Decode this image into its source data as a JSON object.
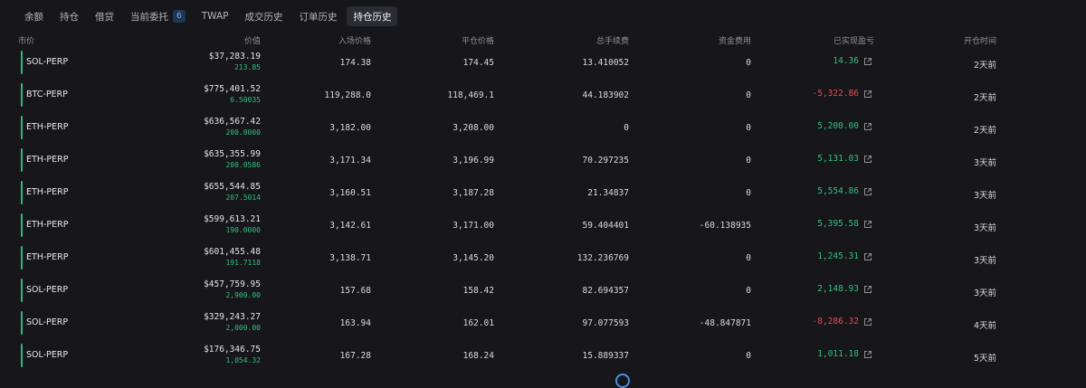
{
  "tabs": [
    {
      "label": "余额",
      "active": false
    },
    {
      "label": "持仓",
      "active": false
    },
    {
      "label": "借贷",
      "active": false
    },
    {
      "label": "当前委托",
      "badge": "6",
      "active": false
    },
    {
      "label": "TWAP",
      "active": false
    },
    {
      "label": "成交历史",
      "active": false
    },
    {
      "label": "订单历史",
      "active": false
    },
    {
      "label": "持仓历史",
      "active": true
    }
  ],
  "columns": {
    "market": "市价",
    "value": "价值",
    "entry_price": "入场价格",
    "close_price": "平仓价格",
    "total_fee": "总手续费",
    "funding": "资金费用",
    "realized_pnl": "已实现盈亏",
    "open_time": "开仓时间"
  },
  "colors": {
    "positive": "#33c07b",
    "negative": "#ea4a4f",
    "accent": "#74adf2"
  },
  "rows": [
    {
      "market": "SOL-PERP",
      "value": "$37,283.19",
      "size": "213.85",
      "entry": "174.38",
      "close": "174.45",
      "fee": "13.410052",
      "funding": "0",
      "pnl": "14.36",
      "pnl_sign": "pos",
      "time": "2天前"
    },
    {
      "market": "BTC-PERP",
      "value": "$775,401.52",
      "size": "6.50035",
      "entry": "119,288.0",
      "close": "118,469.1",
      "fee": "44.183902",
      "funding": "0",
      "pnl": "-5,322.86",
      "pnl_sign": "neg",
      "time": "2天前"
    },
    {
      "market": "ETH-PERP",
      "value": "$636,567.42",
      "size": "200.0000",
      "entry": "3,182.00",
      "close": "3,208.00",
      "fee": "0",
      "funding": "0",
      "pnl": "5,200.00",
      "pnl_sign": "pos",
      "time": "2天前"
    },
    {
      "market": "ETH-PERP",
      "value": "$635,355.99",
      "size": "200.0586",
      "entry": "3,171.34",
      "close": "3,196.99",
      "fee": "70.297235",
      "funding": "0",
      "pnl": "5,131.03",
      "pnl_sign": "pos",
      "time": "3天前"
    },
    {
      "market": "ETH-PERP",
      "value": "$655,544.85",
      "size": "207.5014",
      "entry": "3,160.51",
      "close": "3,187.28",
      "fee": "21.34837",
      "funding": "0",
      "pnl": "5,554.86",
      "pnl_sign": "pos",
      "time": "3天前"
    },
    {
      "market": "ETH-PERP",
      "value": "$599,613.21",
      "size": "190.0000",
      "entry": "3,142.61",
      "close": "3,171.00",
      "fee": "59.404401",
      "funding": "-60.138935",
      "pnl": "5,395.58",
      "pnl_sign": "pos",
      "time": "3天前"
    },
    {
      "market": "ETH-PERP",
      "value": "$601,455.48",
      "size": "191.7118",
      "entry": "3,138.71",
      "close": "3,145.20",
      "fee": "132.236769",
      "funding": "0",
      "pnl": "1,245.31",
      "pnl_sign": "pos",
      "time": "3天前"
    },
    {
      "market": "SOL-PERP",
      "value": "$457,759.95",
      "size": "2,900.00",
      "entry": "157.68",
      "close": "158.42",
      "fee": "82.694357",
      "funding": "0",
      "pnl": "2,148.93",
      "pnl_sign": "pos",
      "time": "3天前"
    },
    {
      "market": "SOL-PERP",
      "value": "$329,243.27",
      "size": "2,000.00",
      "entry": "163.94",
      "close": "162.01",
      "fee": "97.077593",
      "funding": "-48.847871",
      "pnl": "-8,286.32",
      "pnl_sign": "neg",
      "time": "4天前"
    },
    {
      "market": "SOL-PERP",
      "value": "$176,346.75",
      "size": "1,054.32",
      "entry": "167.28",
      "close": "168.24",
      "fee": "15.889337",
      "funding": "0",
      "pnl": "1,011.18",
      "pnl_sign": "pos",
      "time": "5天前"
    }
  ]
}
